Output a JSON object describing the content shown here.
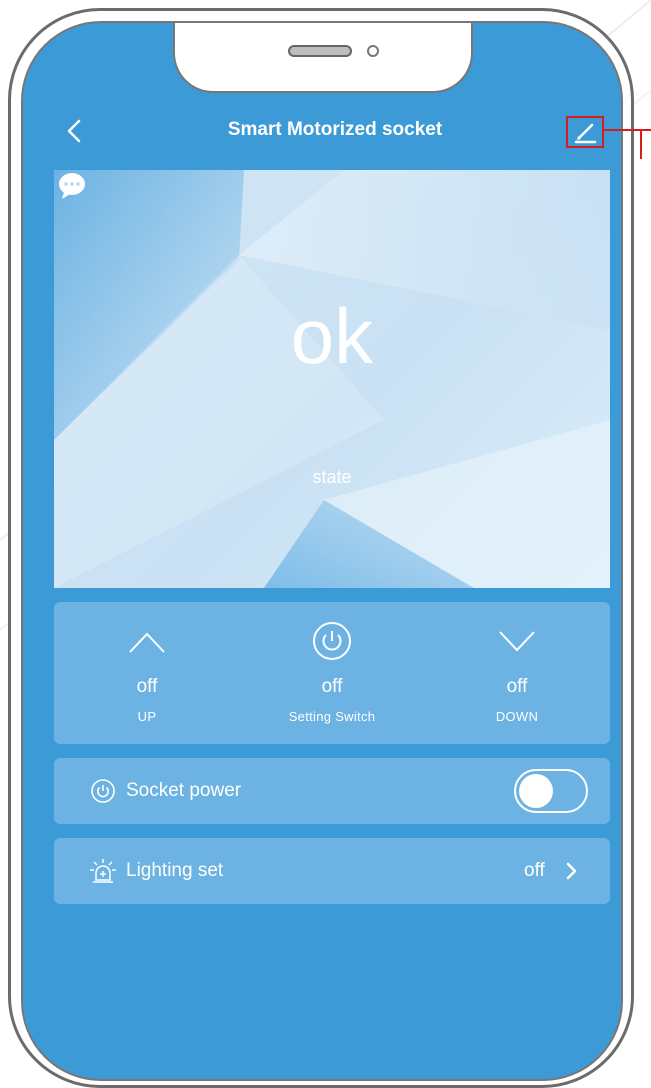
{
  "header": {
    "back_icon": "chevron-left-icon",
    "title": "Smart Motorized socket",
    "edit_icon": "pencil-icon"
  },
  "status": {
    "value": "ok",
    "icon": "chat-bubble-icon",
    "label": "state"
  },
  "controls": [
    {
      "icon": "chevron-up-icon",
      "state": "off",
      "label": "UP"
    },
    {
      "icon": "power-icon",
      "state": "off",
      "label": "Setting Switch"
    },
    {
      "icon": "chevron-down-icon",
      "state": "off",
      "label": "DOWN"
    }
  ],
  "socket_power": {
    "icon": "power-icon",
    "label": "Socket power",
    "enabled": false
  },
  "lighting": {
    "icon": "alarm-light-icon",
    "label": "Lighting set",
    "value": "off"
  },
  "colors": {
    "screen_bg": "#3c9ad6",
    "panel_bg": "#6cb3e3",
    "annotation": "#d81c1c"
  }
}
